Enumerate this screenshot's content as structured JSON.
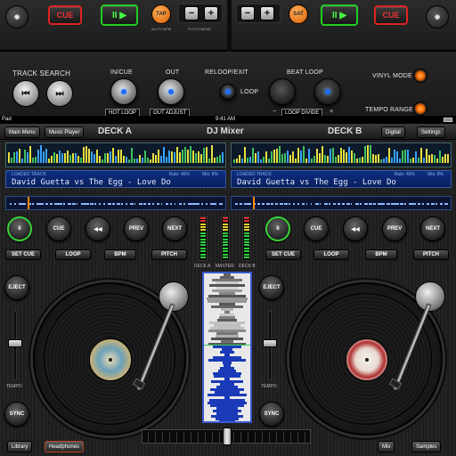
{
  "hardware": {
    "left": {
      "cue_button": "CUE",
      "play_button": "II ▶",
      "tap_button": "TAP",
      "autobpm_label": "AUTO BPM",
      "pitch_bend_label": "PITCH BEND",
      "minus": "−",
      "plus": "+"
    },
    "right": {
      "cue_button": "CUE",
      "play_button": "II ▶",
      "sat_button": "SAT",
      "minus": "−",
      "plus": "+"
    },
    "track_search_label": "TRACK SEARCH",
    "prev_icon": "⏮",
    "next_icon": "⏭",
    "in_cue_label": "IN/CUE",
    "out_label": "OUT",
    "reloop_label": "RELOOP/EXIT",
    "loop_label": "LOOP",
    "beat_loop_label": "BEAT LOOP",
    "hot_loop_tag": "HOT LOOP",
    "out_adjust_tag": "OUT ADJUST",
    "loop_divide_tag": "LOOP DIVIDE",
    "loop_minus": "−",
    "loop_plus": "+",
    "vinyl_mode_label": "VINYL MODE",
    "tempo_range_label": "TEMPO RANGE"
  },
  "status_bar": {
    "carrier": "Pad",
    "time": "9:41 AM"
  },
  "app": {
    "main_menu": "Main Menu",
    "music_player": "Music Player",
    "deck_a_title": "DECK A",
    "center_title": "DJ Mixer",
    "deck_b_title": "DECK B",
    "digital": "Digital",
    "settings": "Settings",
    "deck_a": {
      "loaded_label": "LOADED TRACK",
      "rate": "Rate: 46%",
      "mix": "Mix: 8%",
      "track": "David Guetta vs The Egg - Love Do"
    },
    "deck_b": {
      "loaded_label": "LOADED TRACK",
      "rate": "Rate: 46%",
      "mix": "Mix: 8%",
      "track": "David Guetta vs The Egg - Love Do"
    },
    "transport": {
      "play": "II",
      "cue": "CUE",
      "rew": "◀◀",
      "prev": "PREV",
      "next": "NEXT"
    },
    "functions": {
      "set_cue": "SET CUE",
      "loop": "LOOP",
      "bpm": "BPM",
      "pitch": "PITCH"
    },
    "vu_labels": [
      "DECK A",
      "MASTER",
      "DECK B"
    ],
    "eject": "EJECT",
    "sync": "SYNC",
    "tempo": "TEMPO",
    "library": "Library",
    "headphones": "Headphones",
    "mix": "Mix",
    "samples": "Samples"
  },
  "colors": {
    "accent_blue": "#1f6bff",
    "cue_red": "#dd2222",
    "play_green": "#33cc33",
    "orange": "#ff7a00"
  }
}
